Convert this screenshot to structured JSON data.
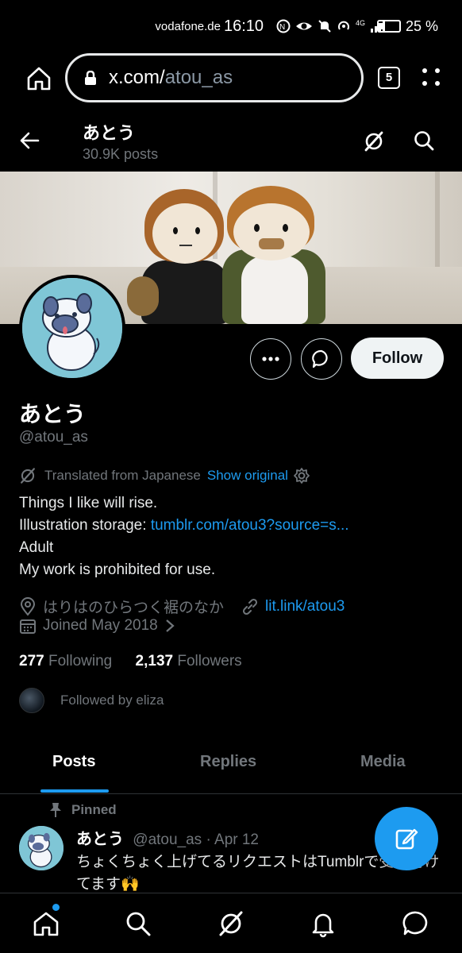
{
  "status_bar": {
    "carrier": "vodafone.de",
    "time": "16:10",
    "network": "4G",
    "battery_percent": "25 %"
  },
  "browser": {
    "url_domain": "x.com/",
    "url_path": "atou_as",
    "tab_count": "5"
  },
  "topbar": {
    "name": "あとう",
    "posts_count": "30.9K posts"
  },
  "profile": {
    "display_name": "あとう",
    "handle": "@atou_as",
    "follow_label": "Follow",
    "translated_label": "Translated from Japanese",
    "show_original_label": "Show original",
    "bio_line1": "Things I like will rise.",
    "bio_line2_prefix": "Illustration storage: ",
    "bio_line2_link": "tumblr.com/atou3?source=s...",
    "bio_line3": "Adult",
    "bio_line4": "My work is prohibited for use.",
    "location": "はりはのひらつく裾のなか",
    "website": "lit.link/atou3",
    "joined": "Joined May 2018",
    "following_count": "277",
    "following_label": "Following",
    "followers_count": "2,137",
    "followers_label": "Followers",
    "followed_by": "Followed by eliza"
  },
  "tabs": [
    {
      "label": "Posts"
    },
    {
      "label": "Replies"
    },
    {
      "label": "Media"
    }
  ],
  "pinned_post": {
    "pinned_label": "Pinned",
    "author": "あとう",
    "handle_date": "@atou_as · Apr 12",
    "text": "ちょくちょく上げてるリクエストはTumblrで受け付けてます🙌"
  },
  "colors": {
    "accent": "#1d9bf0",
    "background": "#000000",
    "muted": "#71767b"
  },
  "icons": [
    "home-icon",
    "lock-icon",
    "tabs-icon",
    "menu-icon",
    "back-icon",
    "grok-icon",
    "search-icon",
    "more-icon",
    "message-icon",
    "translate-icon",
    "settings-icon",
    "location-icon",
    "link-icon",
    "calendar-icon",
    "chevron-right-icon",
    "pin-icon",
    "compose-icon",
    "notifications-icon",
    "messages-icon"
  ]
}
